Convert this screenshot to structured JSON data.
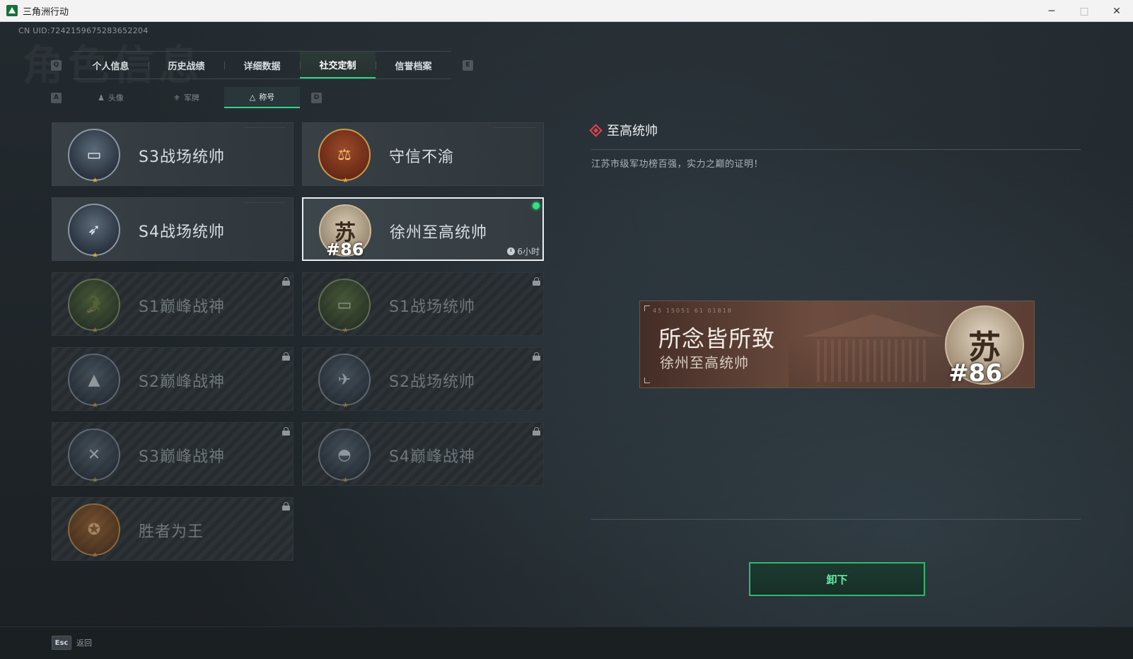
{
  "window": {
    "title": "三角洲行动",
    "controls": {
      "minimize": "─",
      "maximize": "□",
      "close": "✕"
    }
  },
  "header": {
    "uid": "CN UID:7242159675283652204",
    "watermark": "角色信息"
  },
  "tabs": {
    "left_key": "Q",
    "right_key": "E",
    "items": [
      {
        "label": "个人信息",
        "active": false
      },
      {
        "label": "历史战绩",
        "active": false
      },
      {
        "label": "详细数据",
        "active": false
      },
      {
        "label": "社交定制",
        "active": true
      },
      {
        "label": "信誉档案",
        "active": false
      }
    ]
  },
  "subtabs": {
    "left_key": "A",
    "right_key": "D",
    "items": [
      {
        "label": "头像",
        "icon": "person-icon",
        "active": false
      },
      {
        "label": "军牌",
        "icon": "badge-icon",
        "active": false
      },
      {
        "label": "称号",
        "icon": "title-icon",
        "active": true
      }
    ]
  },
  "titles": [
    {
      "name": "S3战场统帅",
      "emblem": "tank-emblem",
      "locked": false
    },
    {
      "name": "守信不渝",
      "emblem": "scales-emblem",
      "locked": false
    },
    {
      "name": "S4战场统帅",
      "emblem": "missile-emblem",
      "locked": false
    },
    {
      "name": "徐州至高统帅",
      "emblem": "su-emblem",
      "rank": "#86",
      "locked": false,
      "selected": true,
      "equipped": true,
      "timer": "6小时"
    },
    {
      "name": "S1巅峰战神",
      "emblem": "crocodile-emblem",
      "locked": true
    },
    {
      "name": "S1战场统帅",
      "emblem": "tank-emblem",
      "locked": true
    },
    {
      "name": "S2巅峰战神",
      "emblem": "pyramid-emblem",
      "locked": true
    },
    {
      "name": "S2战场统帅",
      "emblem": "helicopter-emblem",
      "locked": true
    },
    {
      "name": "S3巅峰战神",
      "emblem": "globe-emblem",
      "locked": true
    },
    {
      "name": "S4巅峰战神",
      "emblem": "helmet-emblem",
      "locked": true
    },
    {
      "name": "胜者为王",
      "emblem": "medal-emblem",
      "locked": true
    }
  ],
  "detail": {
    "title": "至高统帅",
    "description": "江苏市级军功榜百强，实力之巅的证明！",
    "banner": {
      "main_text": "所念皆所致",
      "sub_text": "徐州至高统帅",
      "emblem_char": "苏",
      "rank": "#86",
      "code": "45 15051 61 01818"
    },
    "action_label": "卸下"
  },
  "footer": {
    "esc_key": "Esc",
    "back_label": "返回"
  },
  "colors": {
    "accent": "#2fd58a",
    "equipped_dot": "#2fe37e",
    "diamond": "#e2424a"
  }
}
